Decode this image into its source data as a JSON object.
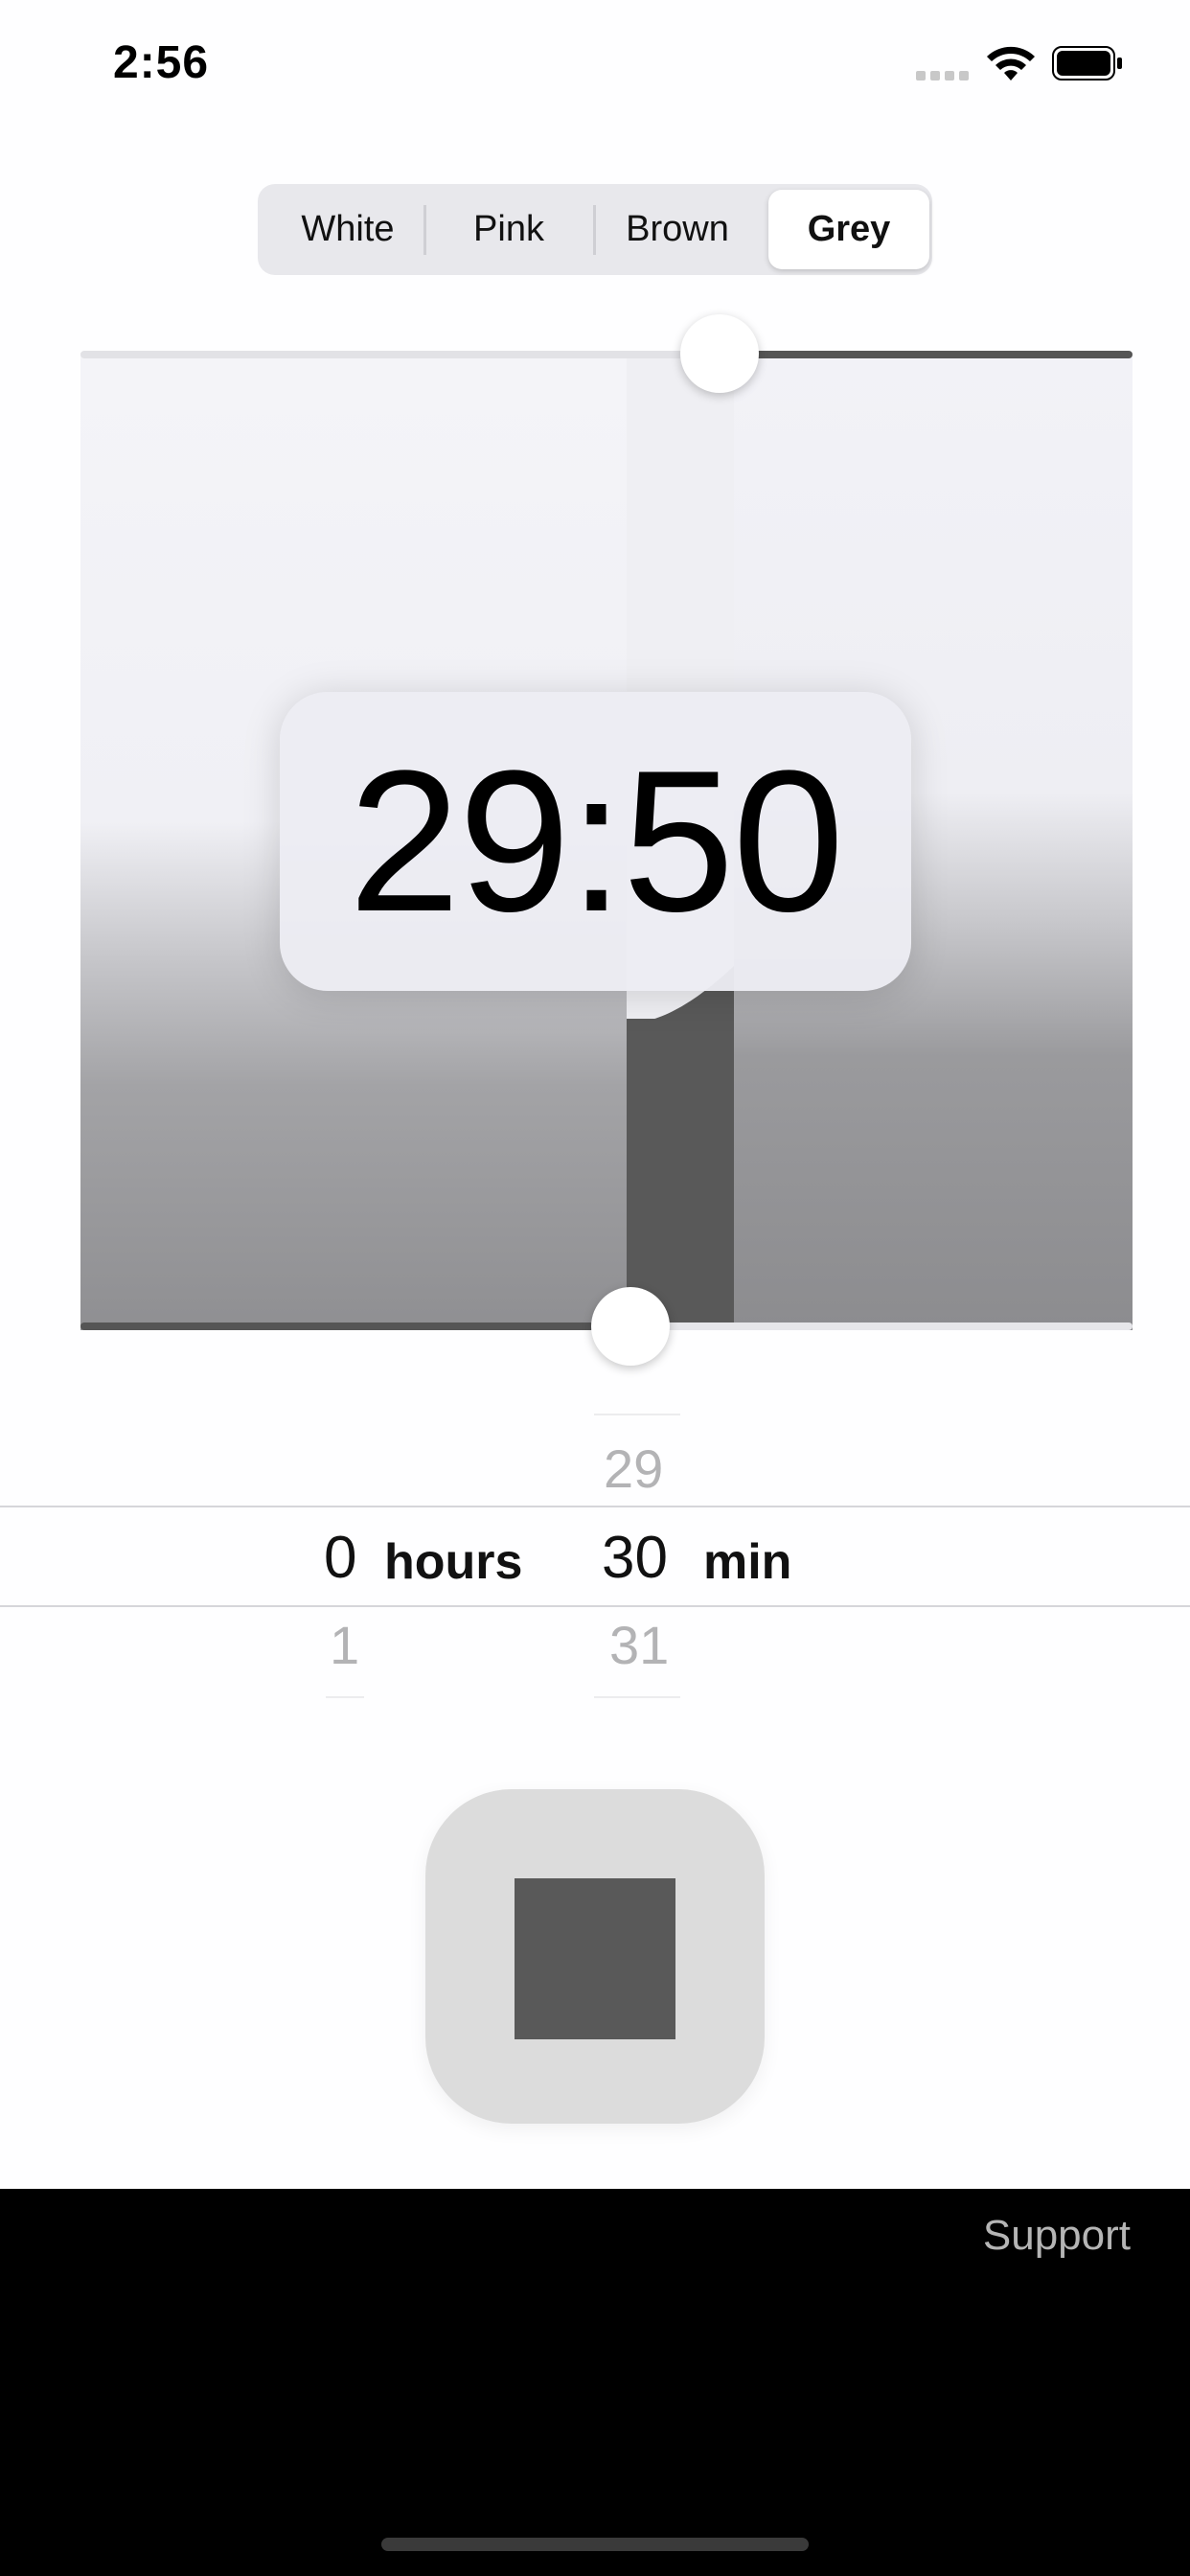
{
  "status_bar": {
    "time": "2:56",
    "icons": [
      "cellular-dots-icon",
      "wifi-icon",
      "battery-icon"
    ]
  },
  "noise_selector": {
    "options": [
      "White",
      "Pink",
      "Brown",
      "Grey"
    ],
    "selected": "Grey"
  },
  "sliders": {
    "top_level": 0.61,
    "bottom_level": 0.52
  },
  "timer": {
    "remaining": "29:50"
  },
  "duration_picker": {
    "hours": {
      "above": "",
      "selected": "0",
      "below": "1",
      "label": "hours"
    },
    "minutes": {
      "above": "29",
      "selected": "30",
      "below": "31",
      "label": "min"
    }
  },
  "playback": {
    "button_icon": "stop-icon"
  },
  "footer": {
    "support_label": "Support"
  },
  "colors": {
    "accent_dark": "#595959",
    "button_bg": "#dcdcdc",
    "footer_bg": "#000000"
  }
}
